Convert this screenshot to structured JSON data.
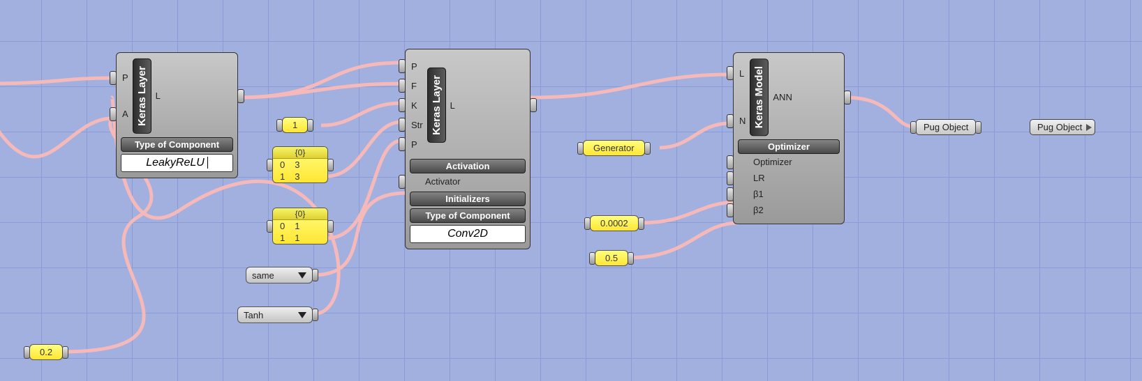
{
  "nodes": {
    "layer1": {
      "name": "Keras Layer",
      "inputs": [
        "P",
        "A"
      ],
      "outputs": [
        "L"
      ],
      "sections": {
        "type_hdr": "Type of Component"
      },
      "value": "LeakyReLU"
    },
    "layer2": {
      "name": "Keras Layer",
      "inputs": [
        "P",
        "F",
        "K",
        "Str",
        "P"
      ],
      "outputs": [
        "L"
      ],
      "act_hdr": "Activation",
      "act_row": "Activator",
      "init_hdr": "Initializers",
      "type_hdr": "Type of Component",
      "value": "Conv2D"
    },
    "model": {
      "name": "Keras Model",
      "inputs": [
        "L",
        "N"
      ],
      "outputs": [
        "ANN"
      ],
      "opt_hdr": "Optimizer",
      "opt_rows": [
        "Optimizer",
        "LR",
        "β1",
        "β2"
      ]
    }
  },
  "panels": {
    "one": "1",
    "tree33": {
      "hdr": "{0}",
      "rows": [
        [
          "0",
          "3"
        ],
        [
          "1",
          "3"
        ]
      ]
    },
    "tree11": {
      "hdr": "{0}",
      "rows": [
        [
          "0",
          "1"
        ],
        [
          "1",
          "1"
        ]
      ]
    },
    "gen": "Generator",
    "lr": "0.0002",
    "b1": "0.5",
    "alpha": "0.2"
  },
  "drops": {
    "same": "same",
    "tanh": "Tanh"
  },
  "tags": {
    "pug_send": "Pug Object",
    "pug_recv": "Pug Object"
  }
}
